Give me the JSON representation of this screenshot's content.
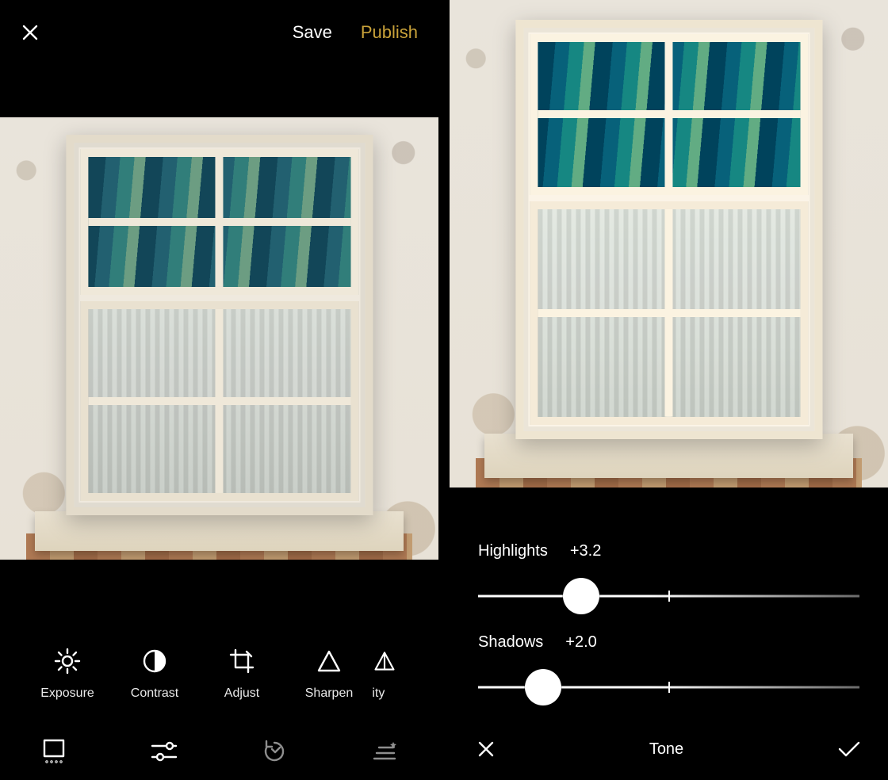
{
  "left": {
    "topbar": {
      "save_label": "Save",
      "publish_label": "Publish"
    },
    "tools": [
      {
        "id": "exposure",
        "label": "Exposure"
      },
      {
        "id": "contrast",
        "label": "Contrast"
      },
      {
        "id": "adjust",
        "label": "Adjust"
      },
      {
        "id": "sharpen",
        "label": "Sharpen"
      },
      {
        "id": "clarity",
        "label": "Clarity",
        "truncated": true
      }
    ],
    "bottom_tabs": [
      {
        "id": "filters",
        "icon": "filters-icon",
        "active": true
      },
      {
        "id": "sliders",
        "icon": "sliders-icon",
        "active": false
      },
      {
        "id": "history",
        "icon": "revert-icon",
        "active": false
      },
      {
        "id": "presets",
        "icon": "presets-icon",
        "active": false
      }
    ]
  },
  "right": {
    "panel_title": "Tone",
    "adjustments": {
      "highlights": {
        "label": "Highlights",
        "value_text": "+3.2",
        "value": 3.2,
        "thumb_percent": 27
      },
      "shadows": {
        "label": "Shadows",
        "value_text": "+2.0",
        "value": 2.0,
        "thumb_percent": 17
      }
    }
  },
  "colors": {
    "accent": "#c9a23a",
    "bg": "#000000",
    "text": "#ffffff",
    "muted": "#8e8e8e"
  }
}
